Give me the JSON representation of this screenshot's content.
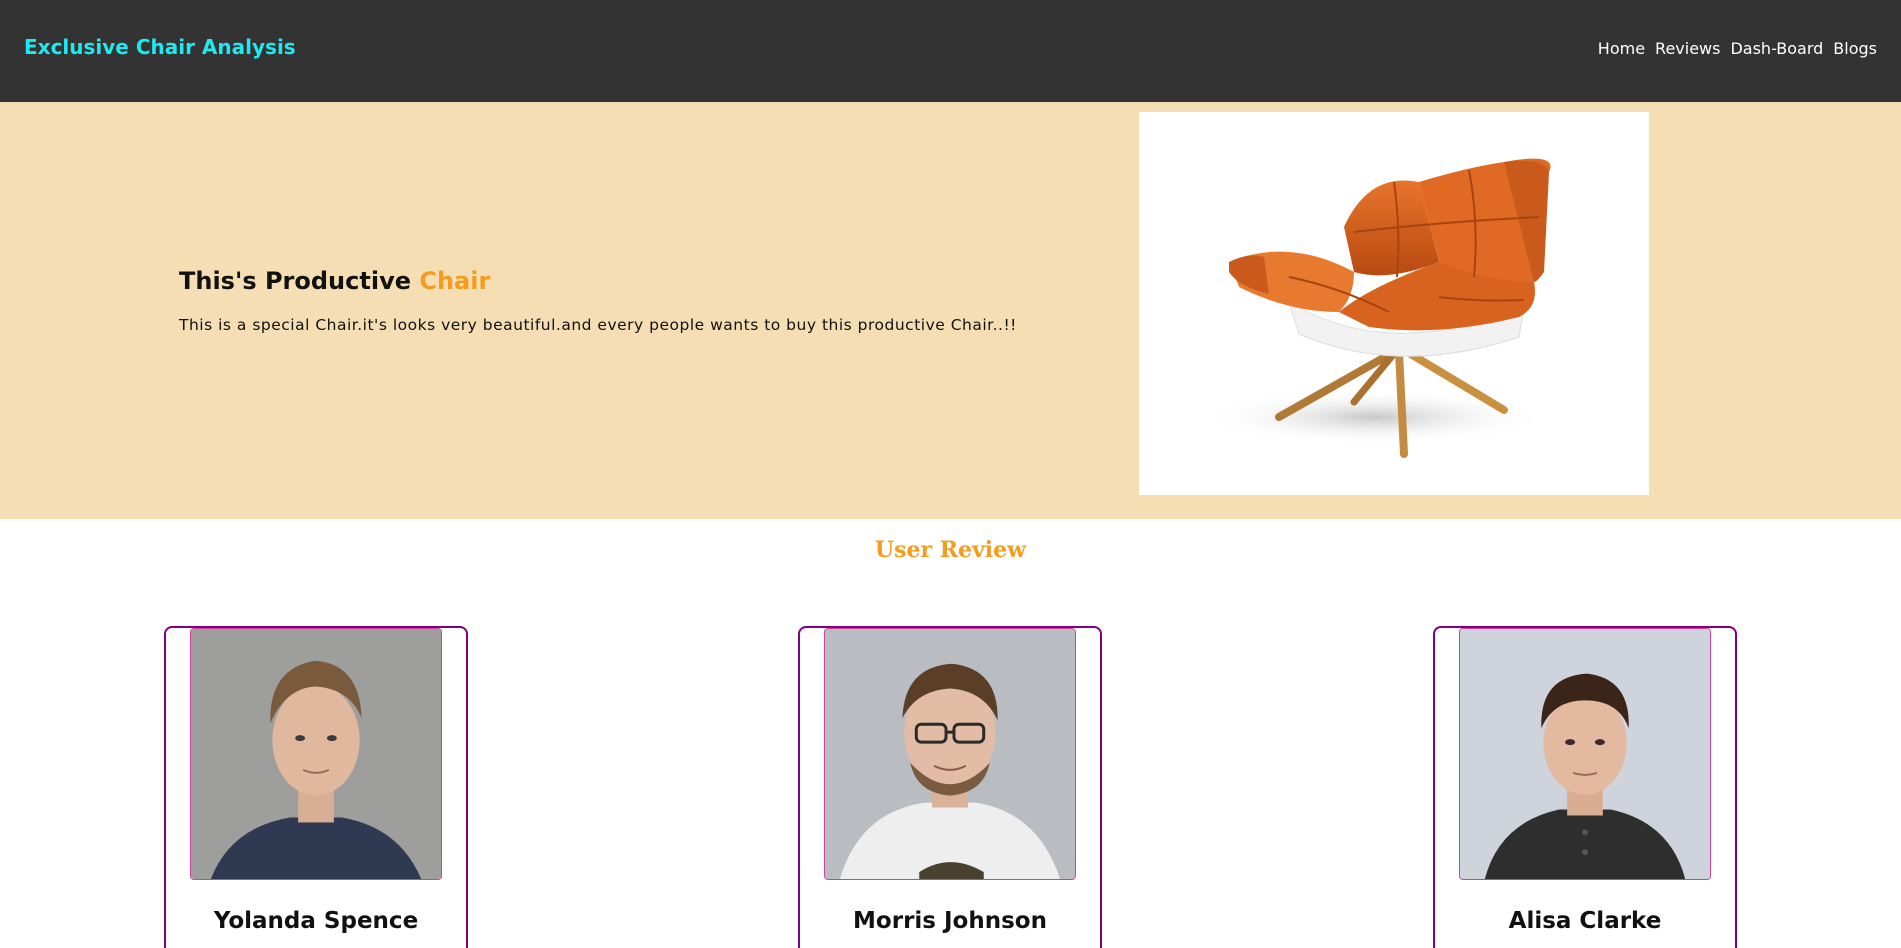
{
  "navbar": {
    "brand": "Exclusive Chair Analysis",
    "links": [
      "Home",
      "Reviews",
      "Dash-Board",
      "Blogs"
    ],
    "brand_color": "#1ee8f0",
    "background": "#333333"
  },
  "hero": {
    "title_prefix": "This's Productive ",
    "title_accent": "Chair",
    "description": "This is a special Chair.it's looks very beautiful.and every people wants to buy this productive Chair..!!",
    "image": "orange-armchair-image",
    "background": "#f5deb3",
    "accent_color": "#f39c1f"
  },
  "reviews": {
    "heading": "User Review",
    "cards": [
      {
        "name": "Yolanda Spence",
        "photo": "reviewer-photo"
      },
      {
        "name": "Morris Johnson",
        "photo": "reviewer-photo"
      },
      {
        "name": "Alisa Clarke",
        "photo": "reviewer-photo"
      }
    ],
    "card_border_color": "#800080"
  }
}
